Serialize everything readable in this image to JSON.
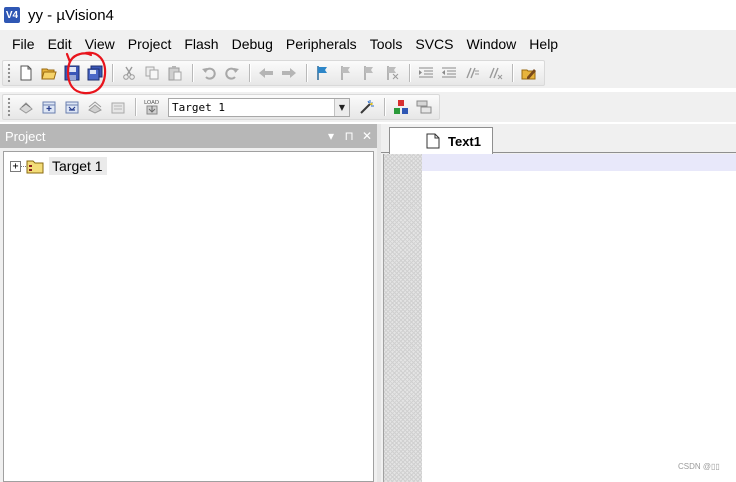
{
  "window": {
    "title": "yy  - µVision4",
    "app_icon_text": "V4"
  },
  "menu": [
    "File",
    "Edit",
    "View",
    "Project",
    "Flash",
    "Debug",
    "Peripherals",
    "Tools",
    "SVCS",
    "Window",
    "Help"
  ],
  "build_toolbar": {
    "target_value": "Target 1",
    "load_button_text": "LOAD"
  },
  "project_panel": {
    "title": "Project",
    "controls": {
      "dropdown": "▾",
      "pin": "⊓",
      "close": "✕"
    },
    "tree": {
      "expander": "+",
      "root_label": "Target 1"
    }
  },
  "editor": {
    "tab_label": "Text1"
  },
  "watermark": "CSDN @▯▯",
  "colors": {
    "annotation": "#e8141c",
    "panel_header": "#b7b7b7",
    "current_line": "#e8e8fa",
    "app_icon": "#2f57b4"
  }
}
